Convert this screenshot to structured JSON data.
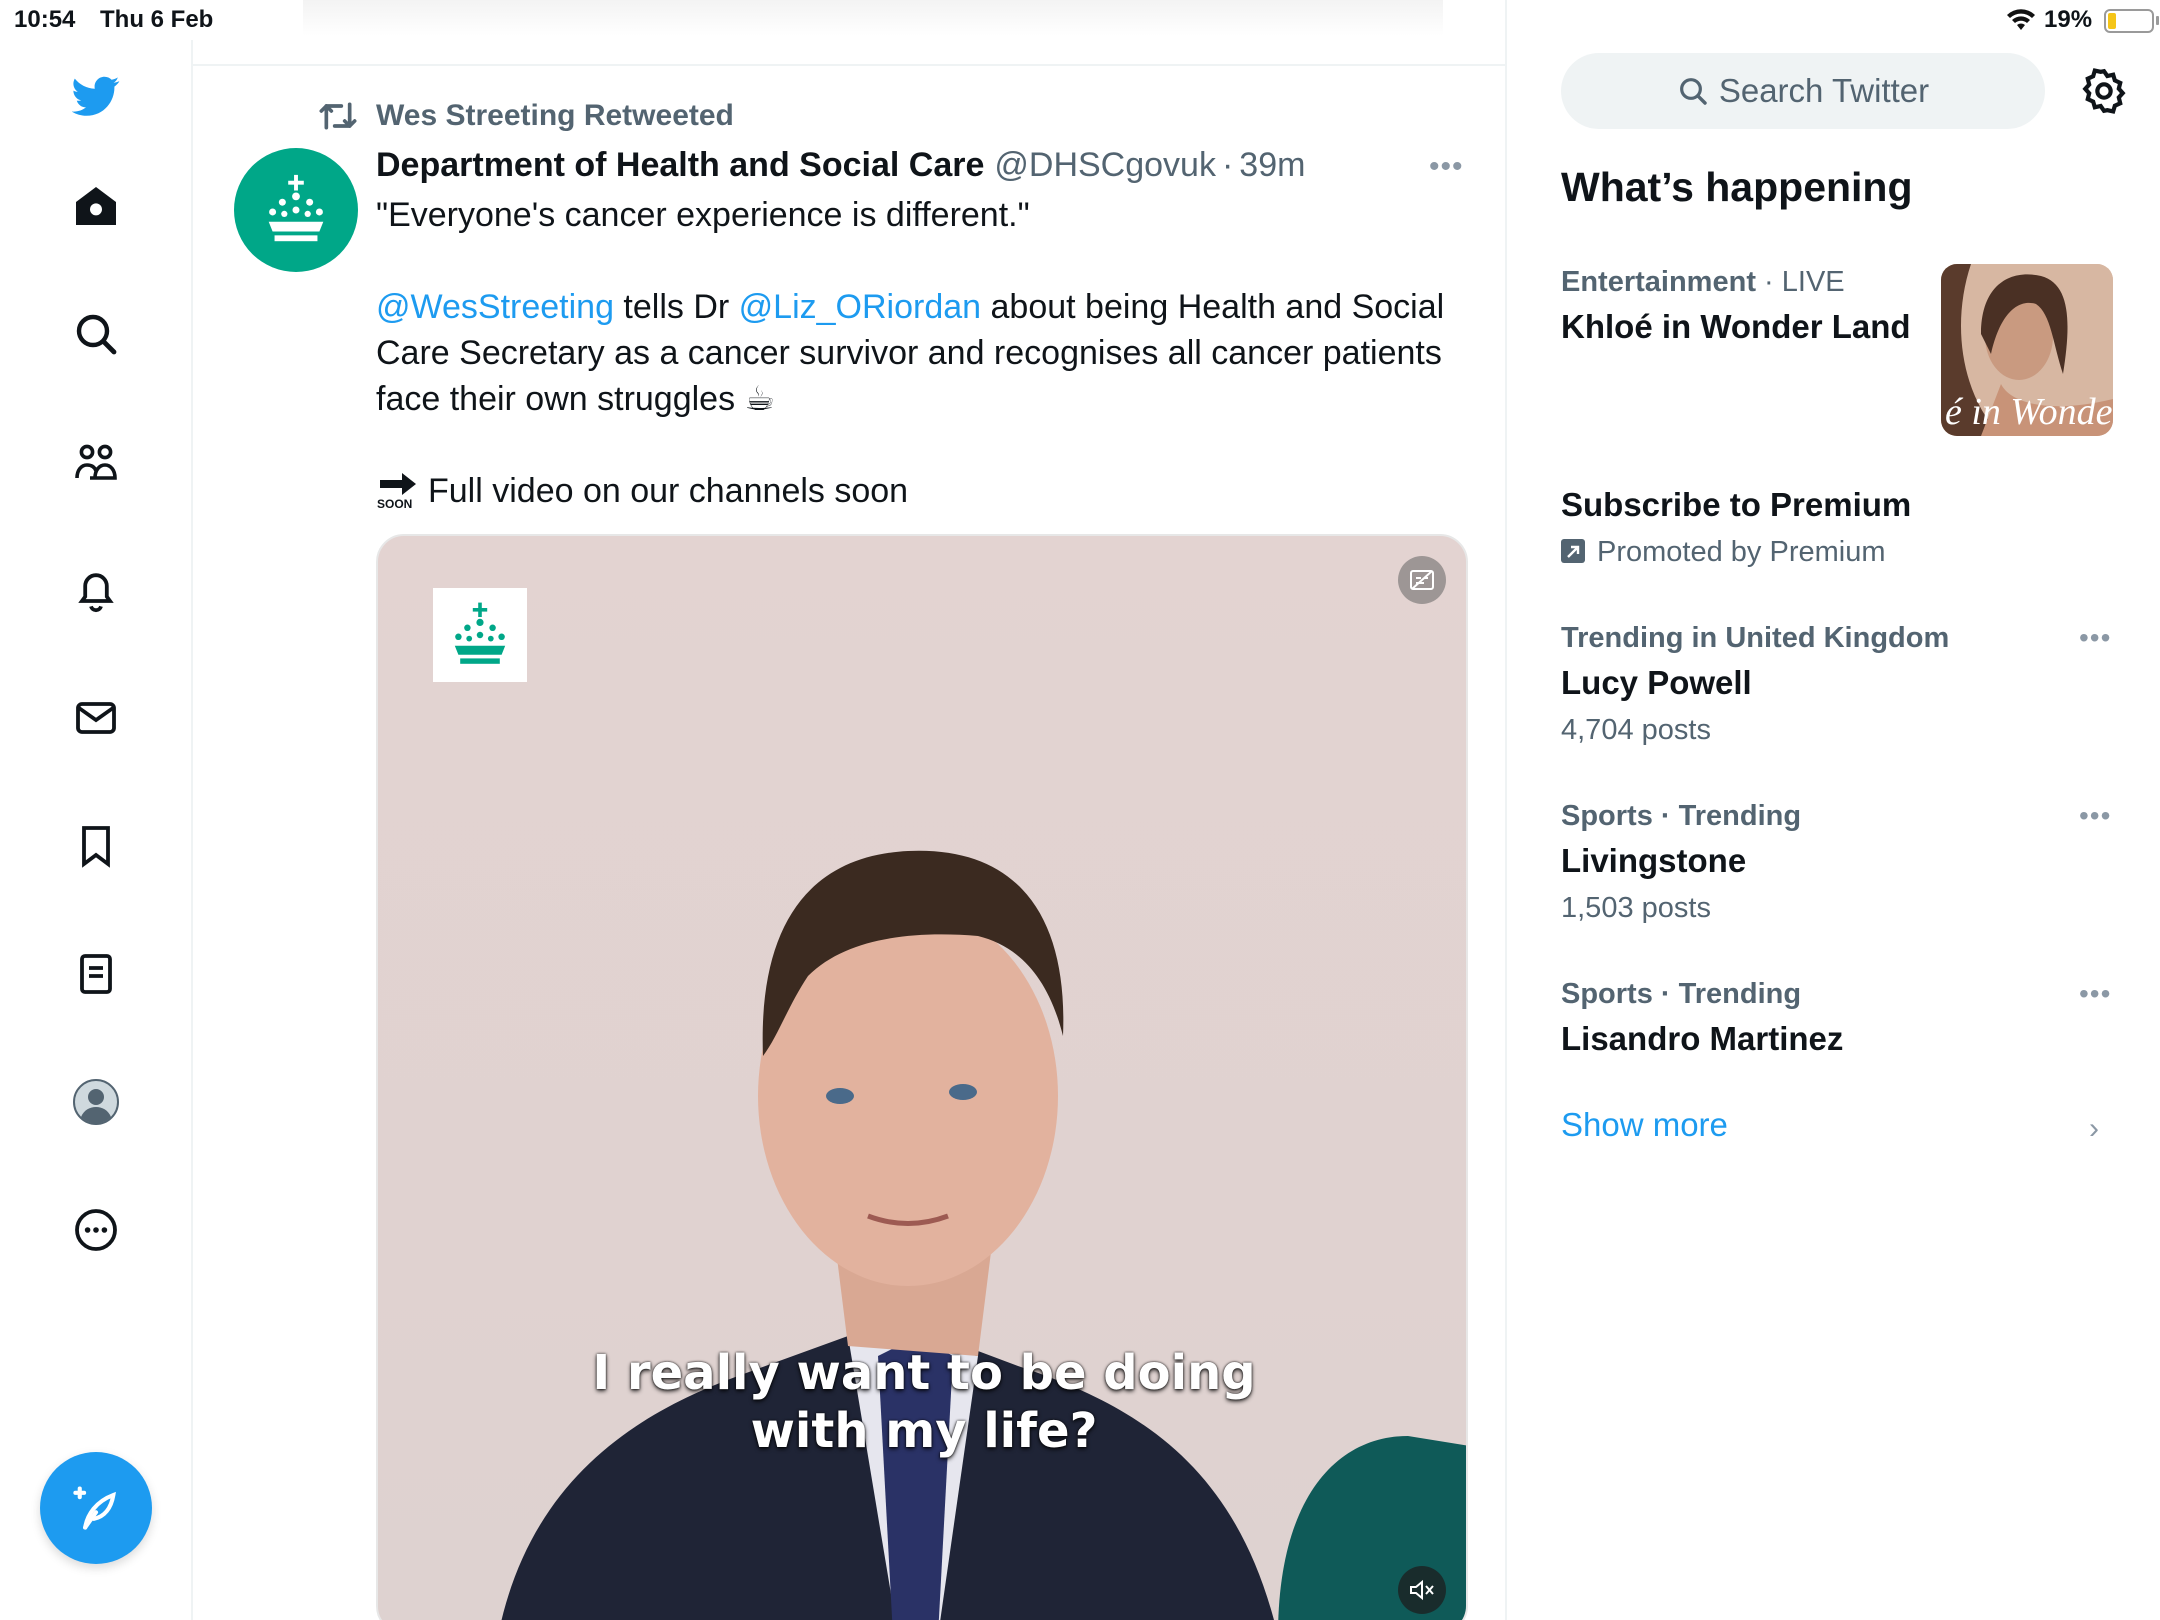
{
  "status_bar": {
    "time": "10:54",
    "date": "Thu 6 Feb",
    "battery": "19%",
    "battery_level": 0.19
  },
  "nav": {
    "items": [
      "twitter-logo",
      "home",
      "explore",
      "communities",
      "notifications",
      "messages",
      "bookmarks",
      "lists",
      "profile",
      "more"
    ],
    "compose_label": "Compose"
  },
  "tweet": {
    "retweeted_by": "Wes Streeting Retweeted",
    "author_name": "Department of Health and Social Care",
    "author_handle": "@DHSCgovuk",
    "separator": "·",
    "time": "39m",
    "line1": "\"Everyone's cancer experience is different.\"",
    "mention1": "@WesStreeting",
    "text_a": " tells Dr ",
    "mention2": "@Liz_ORiordan",
    "text_b": " about being Health and Social Care Secretary as a cancer survivor and recognises all cancer patients face their own struggles ☕",
    "soon_icon_text": "SOON",
    "line_last": "Full video on our channels soon",
    "video_caption_line1": "I really want to be doing",
    "video_caption_line2": "with my life?"
  },
  "sidebar": {
    "search_placeholder": "Search Twitter",
    "heading": "What’s happening",
    "live": {
      "category": "Entertainment",
      "sep": " · ",
      "status": "LIVE",
      "title": "Khloé in Wonder Land",
      "thumb_text": "é in Wonder l"
    },
    "promo": {
      "title": "Subscribe to Premium",
      "label": "Promoted by Premium"
    },
    "trends": [
      {
        "context": "Trending in United Kingdom",
        "title": "Lucy Powell",
        "posts": "4,704 posts"
      },
      {
        "context": "Sports · Trending",
        "title": "Livingstone",
        "posts": "1,503 posts"
      },
      {
        "context": "Sports · Trending",
        "title": "Lisandro Martinez",
        "posts": ""
      }
    ],
    "show_more": "Show more"
  },
  "colors": {
    "accent": "#1d9bf0",
    "dhsc_green": "#00a788",
    "text_primary": "#0f1419",
    "text_secondary": "#536471"
  }
}
